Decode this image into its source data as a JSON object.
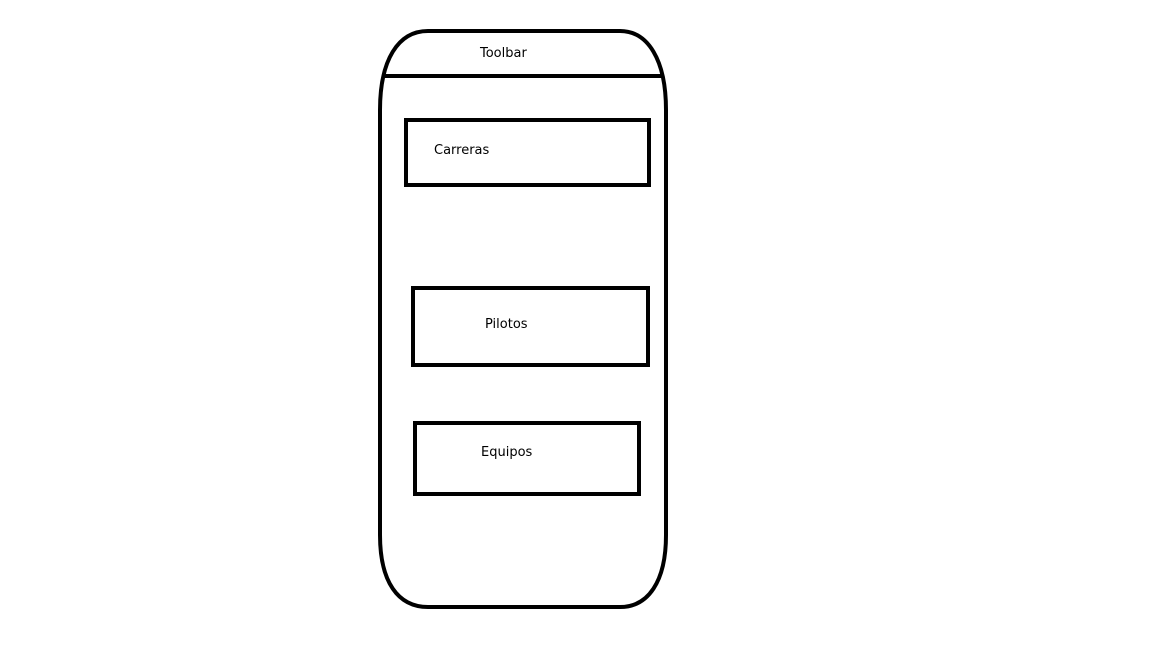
{
  "toolbar": {
    "title": "Toolbar"
  },
  "menu": {
    "items": [
      {
        "label": "Carreras"
      },
      {
        "label": "Pilotos"
      },
      {
        "label": "Equipos"
      }
    ]
  },
  "colors": {
    "stroke": "#000000",
    "background": "#ffffff"
  }
}
